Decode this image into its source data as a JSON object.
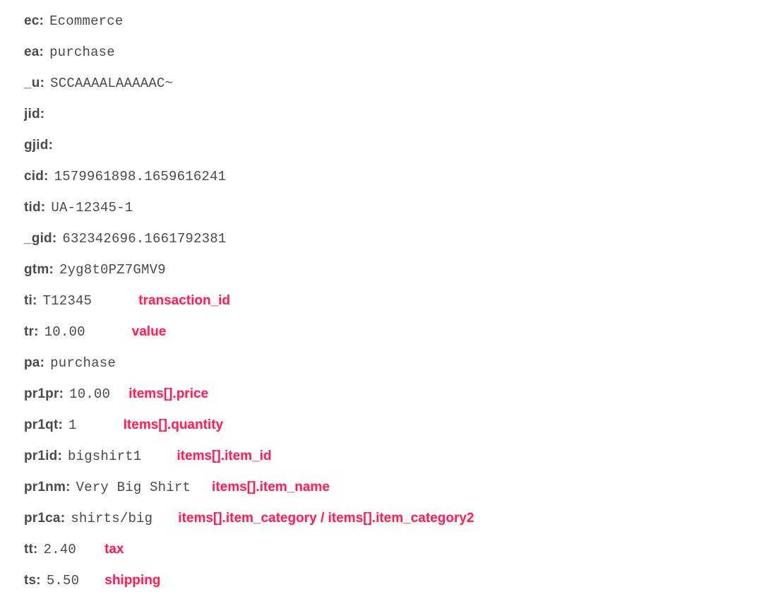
{
  "params": {
    "ec": {
      "key": "ec:",
      "value": "Ecommerce"
    },
    "ea": {
      "key": "ea:",
      "value": "purchase"
    },
    "_u": {
      "key": "_u:",
      "value": "SCCAAAALAAAAAC~"
    },
    "jid": {
      "key": "jid:",
      "value": ""
    },
    "gjid": {
      "key": "gjid:",
      "value": ""
    },
    "cid": {
      "key": "cid:",
      "value": "1579961898.1659616241"
    },
    "tid": {
      "key": "tid:",
      "value": "UA-12345-1"
    },
    "_gid": {
      "key": "_gid:",
      "value": "632342696.1661792381"
    },
    "gtm": {
      "key": "gtm:",
      "value": "2yg8t0PZ7GMV9"
    },
    "ti": {
      "key": "ti:",
      "value": "T12345",
      "annotation": "transaction_id"
    },
    "tr": {
      "key": "tr:",
      "value": "10.00",
      "annotation": "value"
    },
    "pa": {
      "key": "pa:",
      "value": "purchase"
    },
    "pr1pr": {
      "key": "pr1pr:",
      "value": "10.00",
      "annotation": "items[].price"
    },
    "pr1qt": {
      "key": "pr1qt:",
      "value": "1",
      "annotation": "Items[].quantity"
    },
    "pr1id": {
      "key": "pr1id:",
      "value": "bigshirt1",
      "annotation": "items[].item_id"
    },
    "pr1nm": {
      "key": "pr1nm:",
      "value": "Very Big Shirt",
      "annotation": "items[].item_name"
    },
    "pr1ca": {
      "key": "pr1ca:",
      "value": "shirts/big",
      "annotation": "items[].item_category / items[].item_category2"
    },
    "tt": {
      "key": "tt:",
      "value": "2.40",
      "annotation": "tax"
    },
    "ts": {
      "key": "ts:",
      "value": "5.50",
      "annotation": "shipping"
    }
  }
}
